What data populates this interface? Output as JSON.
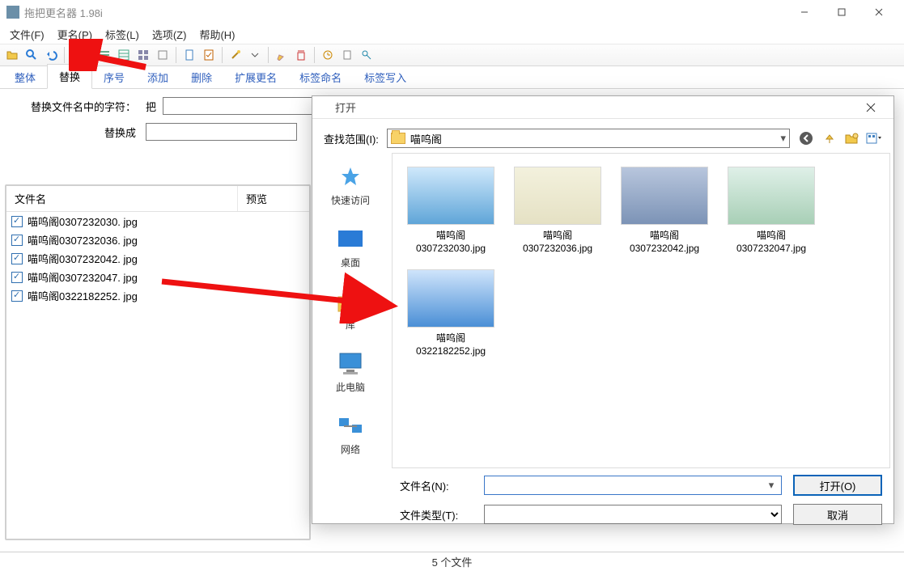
{
  "window": {
    "title": "拖把更名器 1.98i"
  },
  "menu": {
    "file": "文件(F)",
    "rename": "更名(P)",
    "tags": "标签(L)",
    "options": "选项(Z)",
    "help": "帮助(H)"
  },
  "tabs": {
    "whole": "整体",
    "replace": "替换",
    "serial": "序号",
    "add": "添加",
    "delete": "删除",
    "ext": "扩展更名",
    "tagname": "标签命名",
    "tagwrite": "标签写入"
  },
  "replace_panel": {
    "row1_label": "替换文件名中的字符：",
    "row1_sublabel": "把",
    "row1_value": "",
    "row2_label": "替换成",
    "row2_value": ""
  },
  "filelist": {
    "col_name": "文件名",
    "col_preview": "预览",
    "items": [
      "喵呜阁0307232030. jpg",
      "喵呜阁0307232036. jpg",
      "喵呜阁0307232042. jpg",
      "喵呜阁0307232047. jpg",
      "喵呜阁0322182252. jpg"
    ]
  },
  "statusbar": {
    "count": "5 个文件"
  },
  "dialog": {
    "title": "打开",
    "look_in_label": "查找范围(I):",
    "look_in_value": "喵呜阁",
    "places": {
      "quick": "快速访问",
      "desktop": "桌面",
      "lib": "库",
      "pc": "此电脑",
      "net": "网络"
    },
    "thumbs": [
      {
        "l1": "喵呜阁",
        "l2": "0307232030.jpg",
        "grad": [
          "#cfe8fb",
          "#5fa5d8"
        ]
      },
      {
        "l1": "喵呜阁",
        "l2": "0307232036.jpg",
        "grad": [
          "#f3f1dd",
          "#e5e1c4"
        ]
      },
      {
        "l1": "喵呜阁",
        "l2": "0307232042.jpg",
        "grad": [
          "#b8c6dd",
          "#7c93b6"
        ]
      },
      {
        "l1": "喵呜阁",
        "l2": "0307232047.jpg",
        "grad": [
          "#dff0e8",
          "#a8cfb6"
        ]
      },
      {
        "l1": "喵呜阁",
        "l2": "0322182252.jpg",
        "grad": [
          "#cfe4fb",
          "#4a8fd6"
        ]
      }
    ],
    "filename_label": "文件名(N):",
    "filetype_label": "文件类型(T):",
    "filename_value": "",
    "filetype_value": "",
    "open_btn": "打开(O)",
    "cancel_btn": "取消"
  }
}
